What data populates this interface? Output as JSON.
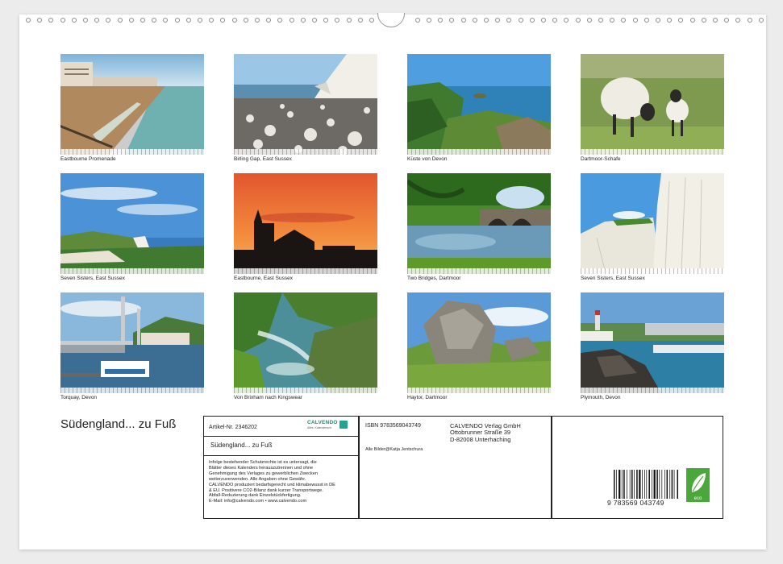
{
  "calendar": {
    "title": "Südengland... zu Fuß",
    "photos": [
      {
        "caption": "Eastbourne Promenade"
      },
      {
        "caption": "Birling Gap, East Sussex"
      },
      {
        "caption": "Küste von Devon"
      },
      {
        "caption": "Dartmoor-Schafe"
      },
      {
        "caption": "Seven Sisters, East Sussex"
      },
      {
        "caption": "Eastbourne, East Sussex"
      },
      {
        "caption": "Two Bridges, Dartmoor"
      },
      {
        "caption": "Seven Sisters, East Sussex"
      },
      {
        "caption": "Torquay, Devon"
      },
      {
        "caption": "Von Brixham nach Kingswear"
      },
      {
        "caption": "Haytor, Dartmoor"
      },
      {
        "caption": "Plymouth, Devon"
      }
    ]
  },
  "info": {
    "article": "Artikel-Nr. 2346202",
    "logo_text": "CALVENDO",
    "logo_sub": "Alles. Kalenderisch.",
    "subtitle": "Südengland... zu Fuß",
    "legal_lines": [
      "Infolge bestehender Schutzrechte ist es untersagt, die",
      "Blätter dieses Kalenders herauszutrennen und ohne",
      "Genehmigung des Verlages zu gewerblichen Zwecken",
      "weiterzuverwenden. Alle Angaben ohne Gewähr.",
      "CALVENDO produziert bedarfsgerecht und klimabewusst in DE",
      "& EU. Positivere CO2-Bilanz dank kurzer Transportwege.",
      "Abfall-Reduzierung dank Einzelstückfertigung.",
      "E-Mail: info@calvendo.com • www.calvendo.com"
    ],
    "isbn": "ISBN 9783569043749",
    "credit": "Alle Bilder@Katja Jentschura",
    "publisher_lines": [
      "CALVENDO Verlag GmbH",
      "Ottobrunner Straße 39",
      "D-82008 Unterhaching"
    ],
    "barcode_digits": "9 783569 043749",
    "eco_label": "eco"
  }
}
